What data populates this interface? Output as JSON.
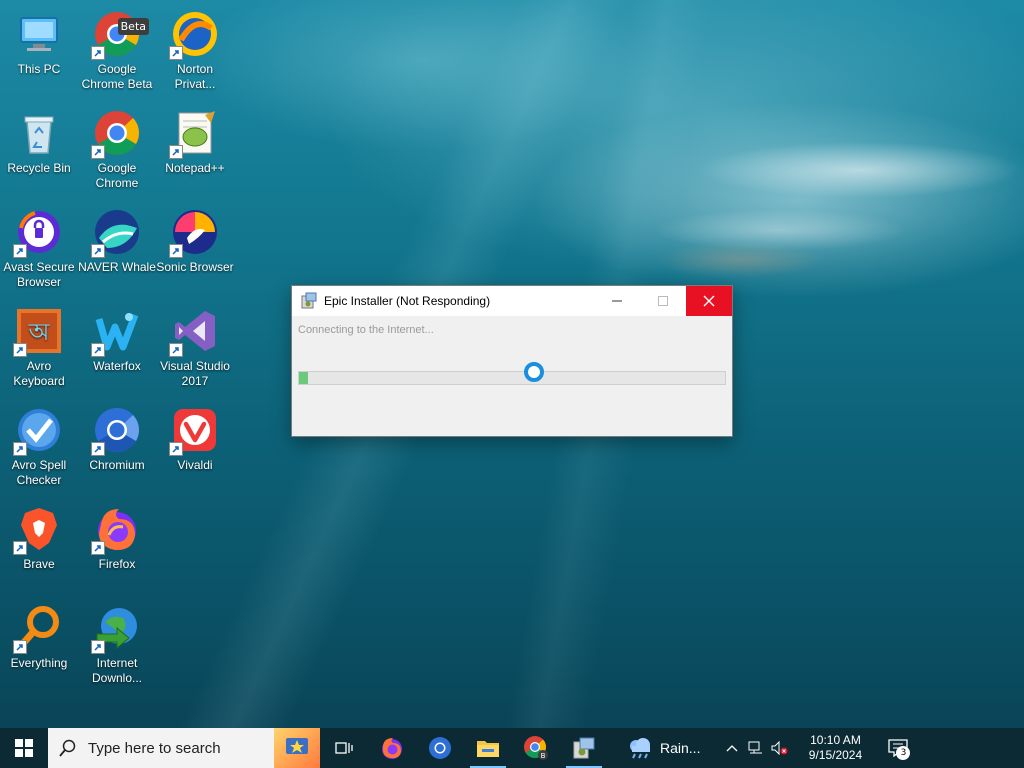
{
  "desktop": {
    "icons": [
      {
        "label": "This PC",
        "icon": "this-pc-icon"
      },
      {
        "label": "Google Chrome Beta",
        "icon": "chrome-beta-icon",
        "badge": "Beta"
      },
      {
        "label": "Norton Privat...",
        "icon": "norton-private-browser-icon"
      },
      {
        "label": "Recycle Bin",
        "icon": "recycle-bin-icon"
      },
      {
        "label": "Google Chrome",
        "icon": "chrome-icon"
      },
      {
        "label": "Notepad++",
        "icon": "notepad-plus-plus-icon"
      },
      {
        "label": "Avast Secure Browser",
        "icon": "avast-secure-browser-icon"
      },
      {
        "label": "NAVER Whale",
        "icon": "naver-whale-icon"
      },
      {
        "label": "Sonic Browser",
        "icon": "sonic-browser-icon"
      },
      {
        "label": "Avro Keyboard",
        "icon": "avro-keyboard-icon"
      },
      {
        "label": "Waterfox",
        "icon": "waterfox-icon"
      },
      {
        "label": "Visual Studio 2017",
        "icon": "visual-studio-icon"
      },
      {
        "label": "Avro Spell Checker",
        "icon": "avro-spell-checker-icon"
      },
      {
        "label": "Chromium",
        "icon": "chromium-icon"
      },
      {
        "label": "Vivaldi",
        "icon": "vivaldi-icon"
      },
      {
        "label": "Brave",
        "icon": "brave-icon"
      },
      {
        "label": "Firefox",
        "icon": "firefox-icon"
      },
      {
        "label": "Everything",
        "icon": "everything-search-icon"
      },
      {
        "label": "Internet Downlo...",
        "icon": "internet-download-manager-icon"
      }
    ]
  },
  "dialog": {
    "title": "Epic Installer (Not Responding)",
    "status": "Connecting to the Internet...",
    "progress_fraction": 0.02,
    "colors": {
      "close_button": "#e81123",
      "progress": "#06b025",
      "spinner": "#1a8fe0"
    }
  },
  "taskbar": {
    "search_placeholder": "Type here to search",
    "apps": [
      {
        "name": "task-view-icon"
      },
      {
        "name": "firefox-icon"
      },
      {
        "name": "chromium-icon"
      },
      {
        "name": "file-explorer-icon",
        "active": true
      },
      {
        "name": "chrome-beta-icon"
      },
      {
        "name": "installer-icon",
        "active": true
      }
    ],
    "weather": {
      "text": "Rain...",
      "icon": "rain-cloud-icon"
    },
    "clock": {
      "time": "10:10 AM",
      "date": "9/15/2024"
    },
    "notifications": {
      "count": "3"
    }
  }
}
